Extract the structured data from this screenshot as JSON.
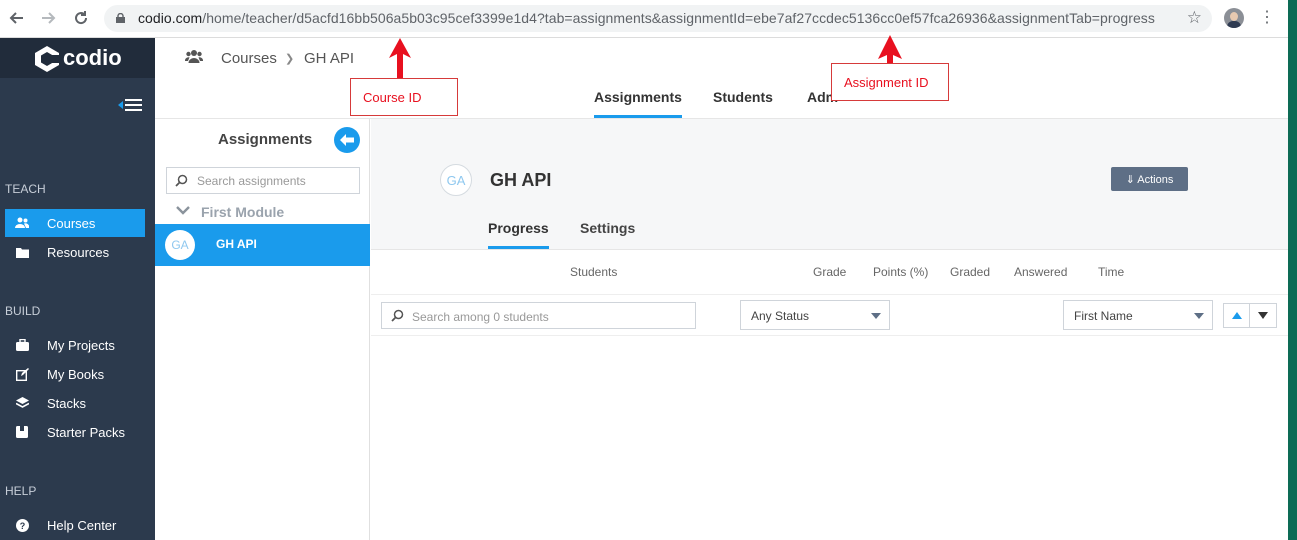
{
  "browser": {
    "url_host": "codio.com",
    "url_path": "/home/teacher/d5acfd16bb506a5b03c95cef3399e1d4?tab=assignments&assignmentId=ebe7af27ccdec5136cc0ef57fca26936&assignmentTab=progress",
    "icons": [
      "back-arrow-icon",
      "forward-arrow-icon",
      "reload-icon",
      "lock-icon",
      "star-icon",
      "kebab-menu-icon"
    ]
  },
  "sidebar": {
    "brand": "codio",
    "sections": [
      {
        "title": "TEACH",
        "items": [
          {
            "label": "Courses",
            "icon": "users-icon",
            "active": true
          },
          {
            "label": "Resources",
            "icon": "folder-icon"
          }
        ]
      },
      {
        "title": "BUILD",
        "items": [
          {
            "label": "My Projects",
            "icon": "briefcase-icon"
          },
          {
            "label": "My Books",
            "icon": "edit-icon"
          },
          {
            "label": "Stacks",
            "icon": "layers-icon"
          },
          {
            "label": "Starter Packs",
            "icon": "box-icon"
          }
        ]
      },
      {
        "title": "HELP",
        "items": [
          {
            "label": "Help Center",
            "icon": "help-icon"
          }
        ]
      }
    ]
  },
  "breadcrumb": {
    "courses": "Courses",
    "current": "GH API"
  },
  "top_tabs": [
    "Assignments",
    "Students",
    "Adm"
  ],
  "assignments_panel": {
    "title": "Assignments",
    "search_placeholder": "Search assignments",
    "module": "First Module",
    "items": [
      {
        "initials": "GA",
        "name": "GH API"
      }
    ]
  },
  "content": {
    "initials": "GA",
    "title": "GH API",
    "actions_label": "⇓ Actions",
    "sub_tabs": [
      "Progress",
      "Settings"
    ],
    "columns": [
      "Students",
      "Grade",
      "Points (%)",
      "Graded",
      "Answered",
      "Time"
    ],
    "student_search_placeholder": "Search among 0 students",
    "status_filter": "Any Status",
    "sort_field": "First Name"
  },
  "annotations": {
    "course_id": "Course ID",
    "assignment_id": "Assignment ID"
  },
  "colors": {
    "accent": "#1a9bec",
    "sidebar": "#2c3a4d",
    "annotation": "#e8101f"
  }
}
